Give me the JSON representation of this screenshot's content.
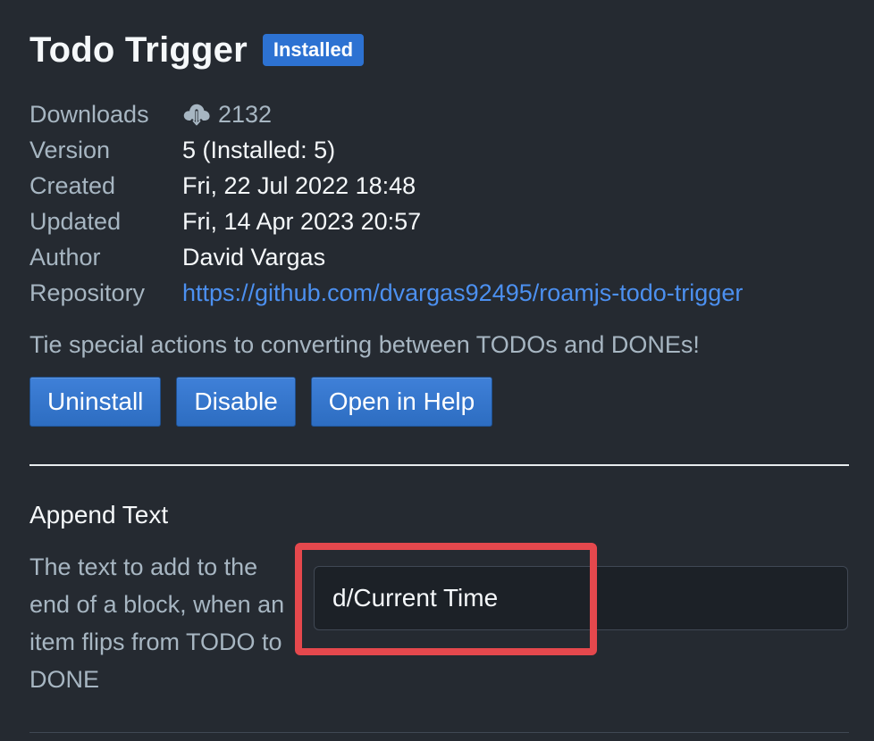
{
  "extension": {
    "title": "Todo Trigger",
    "status_badge": "Installed",
    "meta": {
      "downloads_label": "Downloads",
      "downloads_value": "2132",
      "version_label": "Version",
      "version_value": "5 (Installed: 5)",
      "created_label": "Created",
      "created_value": "Fri, 22 Jul 2022 18:48",
      "updated_label": "Updated",
      "updated_value": "Fri, 14 Apr 2023 20:57",
      "author_label": "Author",
      "author_value": "David Vargas",
      "repository_label": "Repository",
      "repository_value": "https://github.com/dvargas92495/roamjs-todo-trigger"
    },
    "description": "Tie special actions to converting between TODOs and DONEs!",
    "buttons": {
      "uninstall": "Uninstall",
      "disable": "Disable",
      "open_in_help": "Open in Help"
    }
  },
  "settings": {
    "append_text": {
      "title": "Append Text",
      "description": "The text to add to the end of a block, when an item flips from TODO to DONE",
      "value": "d/Current Time"
    }
  },
  "icons": {
    "downloads": "cloud-download-icon"
  },
  "colors": {
    "background": "#252a31",
    "accent": "#2d72d2",
    "link": "#4c90f0",
    "highlight": "#e5484d"
  }
}
